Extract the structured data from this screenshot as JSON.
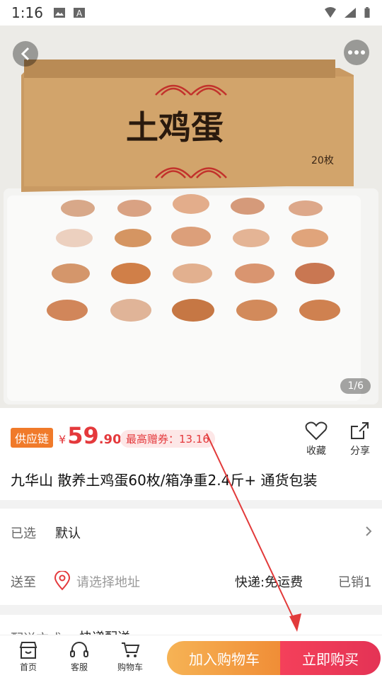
{
  "status_bar": {
    "time": "1:16"
  },
  "hero": {
    "pager": "1/6",
    "box_text": "土鸡蛋",
    "box_count": "20枚"
  },
  "price_panel": {
    "tag": "供应链",
    "currency": "¥",
    "price_int": "59",
    "price_dec": ".90",
    "coupon": "最高赠券：13.16",
    "fav_label": "收藏",
    "share_label": "分享",
    "title": "九华山 散养土鸡蛋60枚/箱净重2.4斤+ 通货包装"
  },
  "selected": {
    "label": "已选",
    "value": "默认"
  },
  "delivery": {
    "label": "送至",
    "placeholder": "请选择地址",
    "shipping": "快递:免运费",
    "sold": "已销1"
  },
  "partial_row": {
    "label": "配送方式",
    "value": "快递配送"
  },
  "bottom_nav": {
    "home": "首页",
    "service": "客服",
    "cart": "购物车",
    "add_to_cart": "加入购物车",
    "buy_now": "立即购买"
  },
  "colors": {
    "accent_red": "#e4393c",
    "tag_orange": "#f07a2a",
    "cart_orange": "#f08d36",
    "buy_red": "#e43355"
  }
}
